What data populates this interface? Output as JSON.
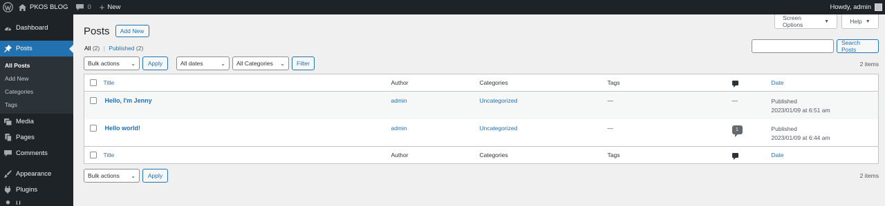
{
  "adminbar": {
    "site_name": "PKOS BLOG",
    "comments_count": "0",
    "new_label": "New",
    "howdy": "Howdy, admin"
  },
  "menu": {
    "dashboard": "Dashboard",
    "posts": "Posts",
    "sub": [
      "All Posts",
      "Add New",
      "Categories",
      "Tags"
    ],
    "media": "Media",
    "pages": "Pages",
    "comments": "Comments",
    "appearance": "Appearance",
    "plugins": "Plugins"
  },
  "header": {
    "screen_options": "Screen Options",
    "help": "Help",
    "title": "Posts",
    "add_new": "Add New"
  },
  "views": {
    "all_label": "All",
    "all_count": "(2)",
    "sep": "|",
    "published_label": "Published",
    "published_count": "(2)"
  },
  "search": {
    "value": "",
    "button": "Search Posts"
  },
  "filters": {
    "bulk_actions": "Bulk actions",
    "apply": "Apply",
    "dates": "All dates",
    "categories": "All Categories",
    "filter": "Filter",
    "items_count": "2 items"
  },
  "table": {
    "columns": {
      "title": "Title",
      "author": "Author",
      "categories": "Categories",
      "tags": "Tags",
      "date": "Date"
    },
    "rows": [
      {
        "title": "Hello, I'm Jenny",
        "author": "admin",
        "categories": "Uncategorized",
        "tags": "—",
        "comments": "—",
        "status": "Published",
        "date": "2023/01/09 at 6:51 am"
      },
      {
        "title": "Hello world!",
        "author": "admin",
        "categories": "Uncategorized",
        "tags": "—",
        "comments": "1",
        "status": "Published",
        "date": "2023/01/09 at 6:44 am"
      }
    ]
  },
  "colors": {
    "adminbar_bg": "#1d2327",
    "accent": "#2271b1",
    "page_bg": "#f0f0f1"
  }
}
